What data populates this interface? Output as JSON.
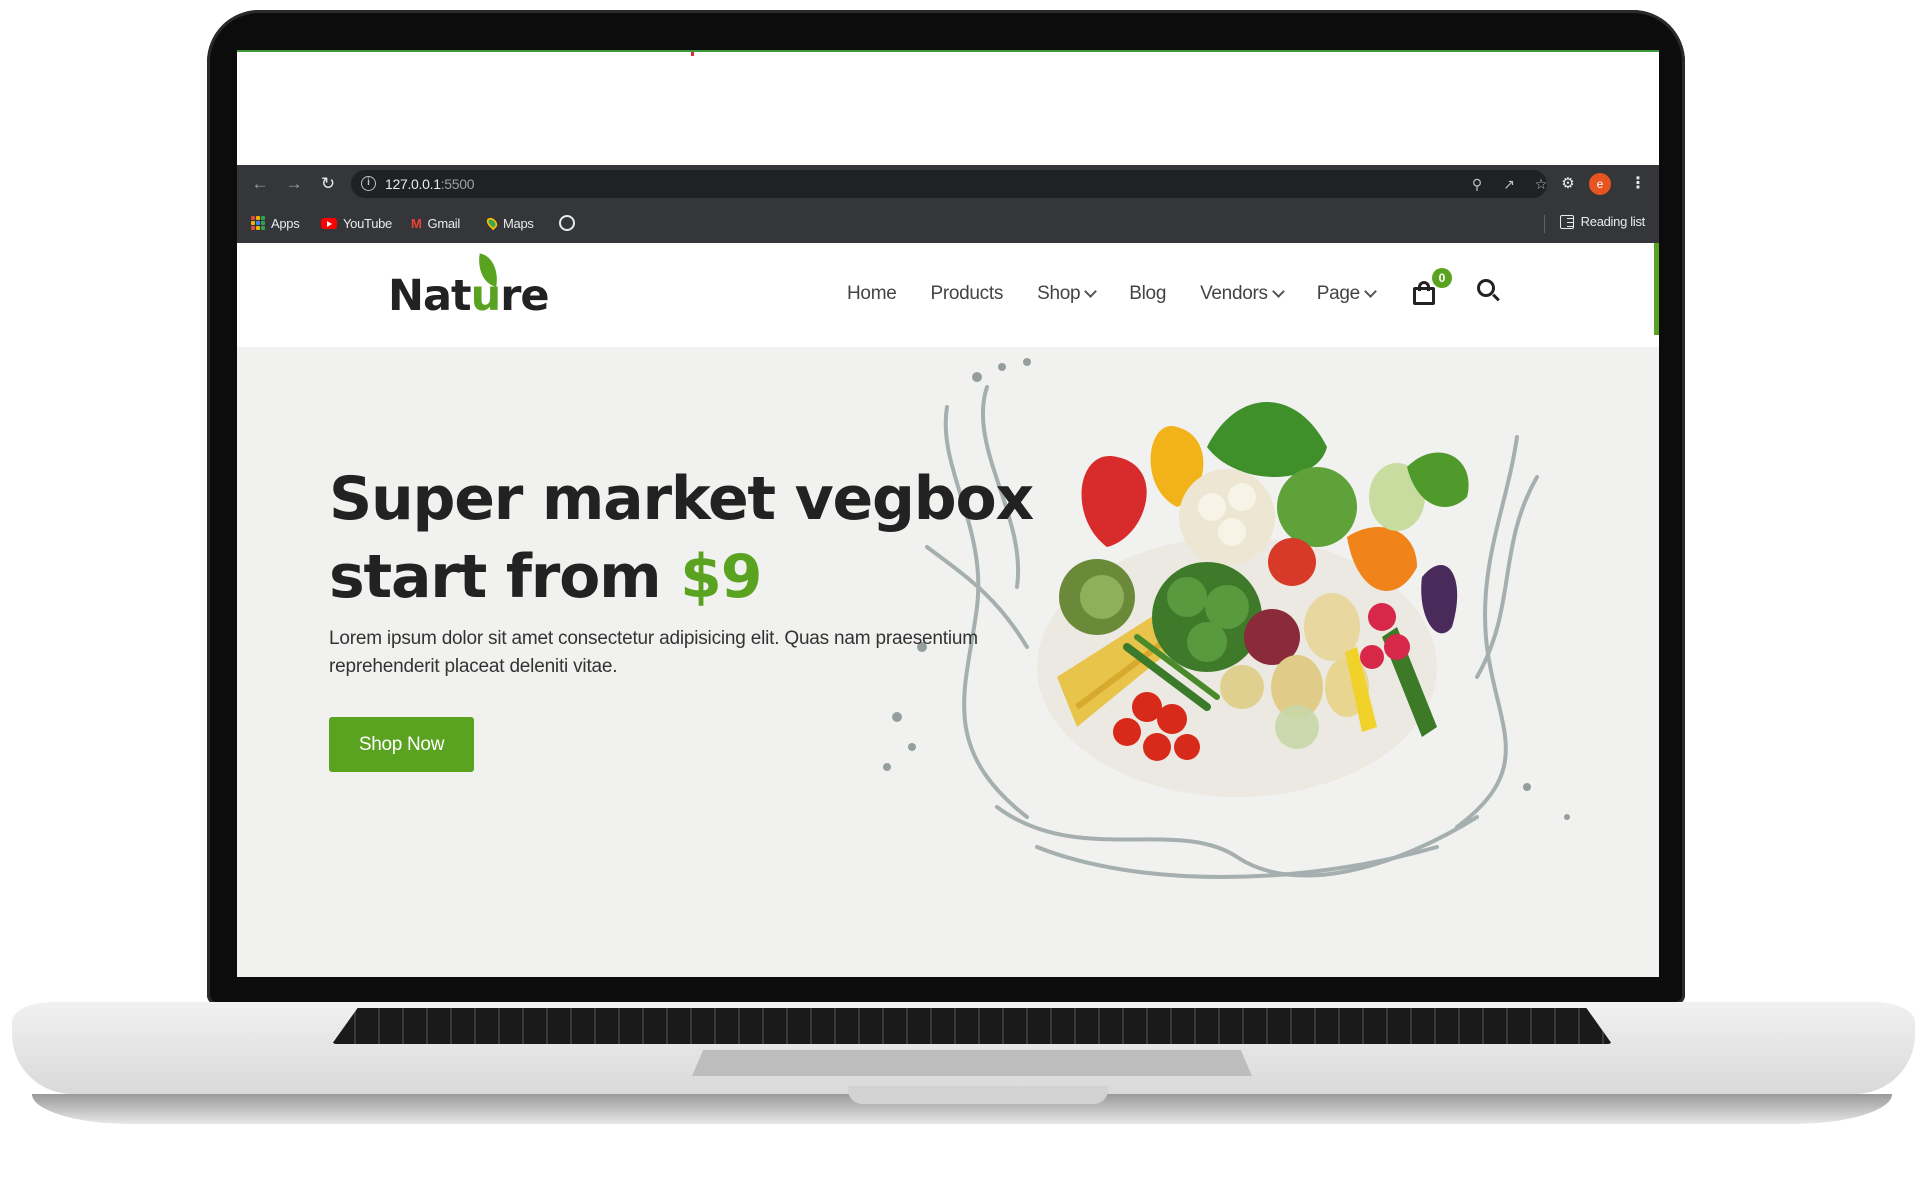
{
  "browser": {
    "url_host": "127.0.0.1",
    "url_port": ":5500",
    "profile_initial": "e",
    "bookmarks": [
      {
        "label": "Apps"
      },
      {
        "label": "YouTube"
      },
      {
        "label": "Gmail"
      },
      {
        "label": "Maps"
      }
    ],
    "reading_list_label": "Reading list"
  },
  "site": {
    "logo": {
      "part1": "Nat",
      "highlight": "u",
      "part2": "re"
    },
    "nav": [
      {
        "label": "Home",
        "has_dropdown": false
      },
      {
        "label": "Products",
        "has_dropdown": false
      },
      {
        "label": "Shop",
        "has_dropdown": true
      },
      {
        "label": "Blog",
        "has_dropdown": false
      },
      {
        "label": "Vendors",
        "has_dropdown": true
      },
      {
        "label": "Page",
        "has_dropdown": true
      }
    ],
    "cart_count": "0",
    "accent_color": "#5aa320"
  },
  "hero": {
    "title_line1": "Super market vegbox",
    "title_line2": "start from ",
    "price": "$9",
    "description": "Lorem ipsum dolor sit amet consectetur adipisicing elit. Quas nam praesentium reprehenderit placeat deleniti vitae.",
    "cta_label": "Shop Now"
  }
}
